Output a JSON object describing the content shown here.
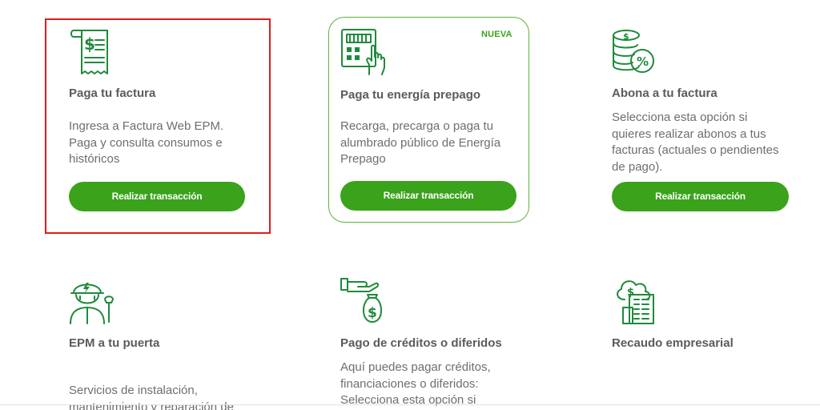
{
  "cards": [
    {
      "icon": "invoice-dollar-icon",
      "title": "Paga tu factura",
      "desc_lines": [
        "Ingresa a Factura Web EPM.",
        "Paga y consulta consumos e",
        "históricos"
      ],
      "button": "Realizar transacción"
    },
    {
      "icon": "calculator-hand-icon",
      "badge": "NUEVA",
      "title": "Paga tu energía prepago",
      "desc_lines": [
        "Recarga, precarga o paga tu",
        "alumbrado público de Energía",
        "Prepago"
      ],
      "button": "Realizar transacción"
    },
    {
      "icon": "coins-percent-icon",
      "title": "Abona a tu factura",
      "desc_lines": [
        "Selecciona esta opción si",
        "quieres realizar abonos a tus",
        "facturas (actuales o pendientes",
        "de pago)."
      ],
      "button": "Realizar transacción"
    },
    {
      "icon": "technician-icon",
      "title": "EPM a tu puerta",
      "desc_lines": [
        "Servicios de instalación,",
        "mantenimiento y reparación de"
      ]
    },
    {
      "icon": "hand-money-bag-icon",
      "title": "Pago de créditos o diferidos",
      "desc_lines": [
        "Aquí puedes pagar créditos,",
        "financiaciones o diferidos:",
        "Selecciona esta opción si"
      ]
    },
    {
      "icon": "cloud-building-icon",
      "title": "Recaudo empresarial",
      "desc_lines": []
    }
  ],
  "colors": {
    "accent": "#3aa21b",
    "icon": "#1f8a3c",
    "selection": "#e01b1b",
    "title": "#5b5b5b",
    "text": "#6e6e6e"
  }
}
